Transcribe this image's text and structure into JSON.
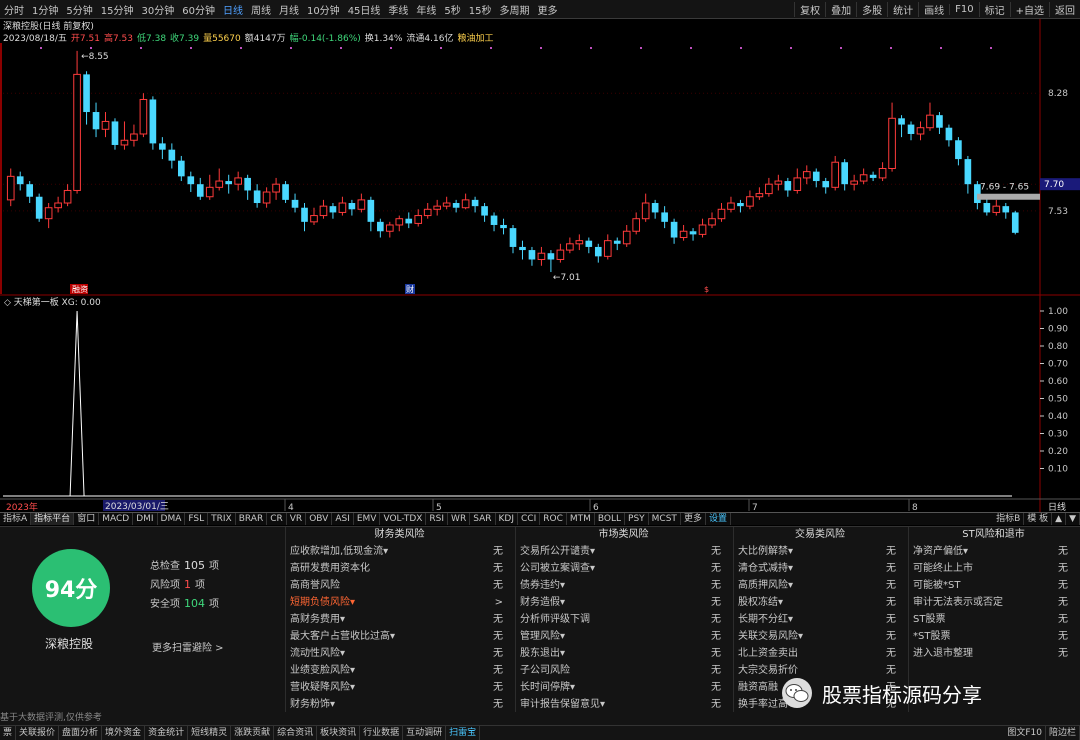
{
  "colors": {
    "up": "#ff3b3b",
    "down": "#4ad8ff",
    "bg": "#000000",
    "accent": "#4fa0ff"
  },
  "toolbar": {
    "timeframes": [
      "分时",
      "1分钟",
      "5分钟",
      "15分钟",
      "30分钟",
      "60分钟",
      "日线",
      "周线",
      "月线",
      "10分钟",
      "45日线",
      "季线",
      "年线",
      "5秒",
      "15秒",
      "多周期",
      "更多"
    ],
    "active_index": 6,
    "right_buttons": [
      "复权",
      "叠加",
      "多股",
      "统计",
      "画线",
      "F10",
      "标记",
      "+自选",
      "返回"
    ]
  },
  "stock_header": {
    "name_line": "深粮控股(日线 前复权)",
    "date": "2023/08/18/五",
    "open": "开7.51",
    "high": "高7.53",
    "low": "低7.38",
    "close": "收7.39",
    "volume": "量55670",
    "amount": "额4147万",
    "change": "幅-0.14(-1.86%)",
    "turnover": "换1.34%",
    "float": "流通4.16亿",
    "industry": "粮油加工"
  },
  "chart_data": {
    "type": "candlestick",
    "price_labels": [
      "8.28",
      "7.70",
      "7.53"
    ],
    "current_price_tag": "7.70",
    "range_label": "7.69 - 7.65",
    "high_label": "8.55",
    "low_label": "7.01",
    "event_labels": [
      "融资",
      "财",
      "$"
    ],
    "candles": [
      {
        "o": 7.6,
        "c": 7.75,
        "h": 7.8,
        "l": 7.56
      },
      {
        "o": 7.75,
        "c": 7.7,
        "h": 7.78,
        "l": 7.66
      },
      {
        "o": 7.7,
        "c": 7.62,
        "h": 7.72,
        "l": 7.58
      },
      {
        "o": 7.62,
        "c": 7.48,
        "h": 7.64,
        "l": 7.46
      },
      {
        "o": 7.48,
        "c": 7.55,
        "h": 7.58,
        "l": 7.42
      },
      {
        "o": 7.55,
        "c": 7.58,
        "h": 7.62,
        "l": 7.52
      },
      {
        "o": 7.58,
        "c": 7.66,
        "h": 7.7,
        "l": 7.56
      },
      {
        "o": 7.66,
        "c": 8.4,
        "h": 8.55,
        "l": 7.64
      },
      {
        "o": 8.4,
        "c": 8.16,
        "h": 8.42,
        "l": 8.08
      },
      {
        "o": 8.16,
        "c": 8.05,
        "h": 8.22,
        "l": 8.0
      },
      {
        "o": 8.05,
        "c": 8.1,
        "h": 8.16,
        "l": 8.0
      },
      {
        "o": 8.1,
        "c": 7.95,
        "h": 8.12,
        "l": 7.92
      },
      {
        "o": 7.95,
        "c": 7.98,
        "h": 8.1,
        "l": 7.92
      },
      {
        "o": 7.98,
        "c": 8.02,
        "h": 8.08,
        "l": 7.94
      },
      {
        "o": 8.02,
        "c": 8.24,
        "h": 8.28,
        "l": 8.0
      },
      {
        "o": 8.24,
        "c": 7.96,
        "h": 8.26,
        "l": 7.92
      },
      {
        "o": 7.96,
        "c": 7.92,
        "h": 8.0,
        "l": 7.86
      },
      {
        "o": 7.92,
        "c": 7.85,
        "h": 7.96,
        "l": 7.8
      },
      {
        "o": 7.85,
        "c": 7.75,
        "h": 7.88,
        "l": 7.72
      },
      {
        "o": 7.75,
        "c": 7.7,
        "h": 7.78,
        "l": 7.65
      },
      {
        "o": 7.7,
        "c": 7.62,
        "h": 7.74,
        "l": 7.6
      },
      {
        "o": 7.62,
        "c": 7.68,
        "h": 7.76,
        "l": 7.6
      },
      {
        "o": 7.68,
        "c": 7.72,
        "h": 7.8,
        "l": 7.66
      },
      {
        "o": 7.72,
        "c": 7.7,
        "h": 7.76,
        "l": 7.64
      },
      {
        "o": 7.7,
        "c": 7.74,
        "h": 7.78,
        "l": 7.66
      },
      {
        "o": 7.74,
        "c": 7.66,
        "h": 7.76,
        "l": 7.6
      },
      {
        "o": 7.66,
        "c": 7.58,
        "h": 7.7,
        "l": 7.55
      },
      {
        "o": 7.58,
        "c": 7.65,
        "h": 7.68,
        "l": 7.55
      },
      {
        "o": 7.65,
        "c": 7.7,
        "h": 7.74,
        "l": 7.6
      },
      {
        "o": 7.7,
        "c": 7.6,
        "h": 7.72,
        "l": 7.58
      },
      {
        "o": 7.6,
        "c": 7.55,
        "h": 7.64,
        "l": 7.52
      },
      {
        "o": 7.55,
        "c": 7.46,
        "h": 7.58,
        "l": 7.4
      },
      {
        "o": 7.46,
        "c": 7.5,
        "h": 7.55,
        "l": 7.44
      },
      {
        "o": 7.5,
        "c": 7.56,
        "h": 7.6,
        "l": 7.48
      },
      {
        "o": 7.56,
        "c": 7.52,
        "h": 7.58,
        "l": 7.48
      },
      {
        "o": 7.52,
        "c": 7.58,
        "h": 7.62,
        "l": 7.5
      },
      {
        "o": 7.58,
        "c": 7.54,
        "h": 7.6,
        "l": 7.5
      },
      {
        "o": 7.54,
        "c": 7.6,
        "h": 7.64,
        "l": 7.52
      },
      {
        "o": 7.6,
        "c": 7.46,
        "h": 7.62,
        "l": 7.4
      },
      {
        "o": 7.46,
        "c": 7.4,
        "h": 7.48,
        "l": 7.36
      },
      {
        "o": 7.4,
        "c": 7.44,
        "h": 7.46,
        "l": 7.36
      },
      {
        "o": 7.44,
        "c": 7.48,
        "h": 7.5,
        "l": 7.4
      },
      {
        "o": 7.48,
        "c": 7.45,
        "h": 7.52,
        "l": 7.42
      },
      {
        "o": 7.45,
        "c": 7.5,
        "h": 7.54,
        "l": 7.43
      },
      {
        "o": 7.5,
        "c": 7.54,
        "h": 7.58,
        "l": 7.48
      },
      {
        "o": 7.54,
        "c": 7.56,
        "h": 7.6,
        "l": 7.5
      },
      {
        "o": 7.56,
        "c": 7.58,
        "h": 7.62,
        "l": 7.54
      },
      {
        "o": 7.58,
        "c": 7.55,
        "h": 7.6,
        "l": 7.52
      },
      {
        "o": 7.55,
        "c": 7.6,
        "h": 7.64,
        "l": 7.54
      },
      {
        "o": 7.6,
        "c": 7.56,
        "h": 7.62,
        "l": 7.52
      },
      {
        "o": 7.56,
        "c": 7.5,
        "h": 7.58,
        "l": 7.46
      },
      {
        "o": 7.5,
        "c": 7.44,
        "h": 7.52,
        "l": 7.4
      },
      {
        "o": 7.44,
        "c": 7.42,
        "h": 7.48,
        "l": 7.38
      },
      {
        "o": 7.42,
        "c": 7.3,
        "h": 7.44,
        "l": 7.26
      },
      {
        "o": 7.3,
        "c": 7.28,
        "h": 7.34,
        "l": 7.22
      },
      {
        "o": 7.28,
        "c": 7.22,
        "h": 7.3,
        "l": 7.18
      },
      {
        "o": 7.22,
        "c": 7.26,
        "h": 7.3,
        "l": 7.18
      },
      {
        "o": 7.26,
        "c": 7.22,
        "h": 7.28,
        "l": 7.14
      },
      {
        "o": 7.22,
        "c": 7.28,
        "h": 7.32,
        "l": 7.2
      },
      {
        "o": 7.28,
        "c": 7.32,
        "h": 7.36,
        "l": 7.26
      },
      {
        "o": 7.32,
        "c": 7.34,
        "h": 7.38,
        "l": 7.28
      },
      {
        "o": 7.34,
        "c": 7.3,
        "h": 7.36,
        "l": 7.26
      },
      {
        "o": 7.3,
        "c": 7.24,
        "h": 7.32,
        "l": 7.2
      },
      {
        "o": 7.24,
        "c": 7.34,
        "h": 7.38,
        "l": 7.22
      },
      {
        "o": 7.34,
        "c": 7.32,
        "h": 7.36,
        "l": 7.28
      },
      {
        "o": 7.32,
        "c": 7.4,
        "h": 7.44,
        "l": 7.3
      },
      {
        "o": 7.4,
        "c": 7.48,
        "h": 7.52,
        "l": 7.38
      },
      {
        "o": 7.48,
        "c": 7.58,
        "h": 7.64,
        "l": 7.46
      },
      {
        "o": 7.58,
        "c": 7.52,
        "h": 7.6,
        "l": 7.48
      },
      {
        "o": 7.52,
        "c": 7.46,
        "h": 7.56,
        "l": 7.42
      },
      {
        "o": 7.46,
        "c": 7.36,
        "h": 7.48,
        "l": 7.32
      },
      {
        "o": 7.36,
        "c": 7.4,
        "h": 7.44,
        "l": 7.34
      },
      {
        "o": 7.4,
        "c": 7.38,
        "h": 7.42,
        "l": 7.34
      },
      {
        "o": 7.38,
        "c": 7.44,
        "h": 7.48,
        "l": 7.36
      },
      {
        "o": 7.44,
        "c": 7.48,
        "h": 7.52,
        "l": 7.42
      },
      {
        "o": 7.48,
        "c": 7.54,
        "h": 7.58,
        "l": 7.46
      },
      {
        "o": 7.54,
        "c": 7.58,
        "h": 7.62,
        "l": 7.52
      },
      {
        "o": 7.58,
        "c": 7.56,
        "h": 7.6,
        "l": 7.52
      },
      {
        "o": 7.56,
        "c": 7.62,
        "h": 7.66,
        "l": 7.54
      },
      {
        "o": 7.62,
        "c": 7.64,
        "h": 7.68,
        "l": 7.6
      },
      {
        "o": 7.64,
        "c": 7.7,
        "h": 7.74,
        "l": 7.62
      },
      {
        "o": 7.7,
        "c": 7.72,
        "h": 7.76,
        "l": 7.66
      },
      {
        "o": 7.72,
        "c": 7.66,
        "h": 7.74,
        "l": 7.62
      },
      {
        "o": 7.66,
        "c": 7.74,
        "h": 7.8,
        "l": 7.64
      },
      {
        "o": 7.74,
        "c": 7.78,
        "h": 7.82,
        "l": 7.7
      },
      {
        "o": 7.78,
        "c": 7.72,
        "h": 7.8,
        "l": 7.68
      },
      {
        "o": 7.72,
        "c": 7.68,
        "h": 7.74,
        "l": 7.64
      },
      {
        "o": 7.68,
        "c": 7.84,
        "h": 7.88,
        "l": 7.66
      },
      {
        "o": 7.84,
        "c": 7.7,
        "h": 7.86,
        "l": 7.66
      },
      {
        "o": 7.7,
        "c": 7.72,
        "h": 7.76,
        "l": 7.66
      },
      {
        "o": 7.72,
        "c": 7.76,
        "h": 7.8,
        "l": 7.7
      },
      {
        "o": 7.76,
        "c": 7.74,
        "h": 7.78,
        "l": 7.72
      },
      {
        "o": 7.74,
        "c": 7.8,
        "h": 7.84,
        "l": 7.72
      },
      {
        "o": 7.8,
        "c": 8.12,
        "h": 8.22,
        "l": 7.78
      },
      {
        "o": 8.12,
        "c": 8.08,
        "h": 8.14,
        "l": 8.0
      },
      {
        "o": 8.08,
        "c": 8.02,
        "h": 8.1,
        "l": 7.98
      },
      {
        "o": 8.02,
        "c": 8.06,
        "h": 8.1,
        "l": 7.98
      },
      {
        "o": 8.06,
        "c": 8.14,
        "h": 8.22,
        "l": 8.04
      },
      {
        "o": 8.14,
        "c": 8.06,
        "h": 8.16,
        "l": 8.02
      },
      {
        "o": 8.06,
        "c": 7.98,
        "h": 8.08,
        "l": 7.94
      },
      {
        "o": 7.98,
        "c": 7.86,
        "h": 8.0,
        "l": 7.82
      },
      {
        "o": 7.86,
        "c": 7.7,
        "h": 7.88,
        "l": 7.64
      },
      {
        "o": 7.7,
        "c": 7.58,
        "h": 7.72,
        "l": 7.54
      },
      {
        "o": 7.58,
        "c": 7.52,
        "h": 7.62,
        "l": 7.5
      },
      {
        "o": 7.52,
        "c": 7.56,
        "h": 7.6,
        "l": 7.5
      },
      {
        "o": 7.56,
        "c": 7.52,
        "h": 7.58,
        "l": 7.48
      },
      {
        "o": 7.52,
        "c": 7.39,
        "h": 7.53,
        "l": 7.38
      }
    ],
    "ylim": [
      7.0,
      8.6
    ]
  },
  "indicator": {
    "title": "天梯第一板 XG: 0.00",
    "ticks": [
      "1.00",
      "0.90",
      "0.80",
      "0.70",
      "0.60",
      "0.50",
      "0.40",
      "0.30",
      "0.20",
      "0.10"
    ],
    "signals": [
      0,
      0,
      0,
      0,
      0,
      0,
      0,
      1
    ]
  },
  "timeline": {
    "start": "2023年",
    "cursor_date": "2023/03/01/三",
    "months": [
      "4",
      "5",
      "6",
      "7",
      "8"
    ],
    "right_label": "日线"
  },
  "indicator_tabs": [
    "指标A",
    "指标平台",
    "窗口",
    "MACD",
    "DMI",
    "DMA",
    "FSL",
    "TRIX",
    "BRAR",
    "CR",
    "VR",
    "OBV",
    "ASI",
    "EMV",
    "VOL-TDX",
    "RSI",
    "WR",
    "SAR",
    "KDJ",
    "CCI",
    "ROC",
    "MTM",
    "BOLL",
    "PSY",
    "MCST",
    "更多",
    "设置"
  ],
  "indicator_tabs_right": [
    "指标B",
    "模 板",
    "▲",
    "▼"
  ],
  "risk_panel": {
    "score": "94分",
    "stock_name": "深粮控股",
    "total_label": "总检查",
    "total_value": "105",
    "total_unit": "项",
    "risk_label": "风险项",
    "risk_value": "1",
    "risk_unit": "项",
    "safe_label": "安全项",
    "safe_value": "104",
    "safe_unit": "项",
    "more_scan": "更多扫雷避险 >",
    "disclaimer": "基于大数据评测,仅供参考",
    "columns": [
      {
        "title": "财务类风险",
        "items": [
          {
            "label": "应收款增加,低现金流▾",
            "status": "无"
          },
          {
            "label": "高研发费用资本化",
            "status": "无"
          },
          {
            "label": "高商誉风险",
            "status": "无"
          },
          {
            "label": "短期负债风险▾",
            "status": ">",
            "warn": true
          },
          {
            "label": "高财务费用▾",
            "status": "无"
          },
          {
            "label": "最大客户占营收比过高▾",
            "status": "无"
          },
          {
            "label": "流动性风险▾",
            "status": "无"
          },
          {
            "label": "业绩变脸风险▾",
            "status": "无"
          },
          {
            "label": "营收疑降风险▾",
            "status": "无"
          },
          {
            "label": "财务粉饰▾",
            "status": "无"
          }
        ]
      },
      {
        "title": "市场类风险",
        "items": [
          {
            "label": "交易所公开谴责▾",
            "status": "无"
          },
          {
            "label": "公司被立案调查▾",
            "status": "无"
          },
          {
            "label": "债券违约▾",
            "status": "无"
          },
          {
            "label": "财务造假▾",
            "status": "无"
          },
          {
            "label": "分析师评级下调",
            "status": "无"
          },
          {
            "label": "管理风险▾",
            "status": "无"
          },
          {
            "label": "股东退出▾",
            "status": "无"
          },
          {
            "label": "子公司风险",
            "status": "无"
          },
          {
            "label": "长时间停牌▾",
            "status": "无"
          },
          {
            "label": "审计报告保留意见▾",
            "status": "无"
          }
        ]
      },
      {
        "title": "交易类风险",
        "items": [
          {
            "label": "大比例解禁▾",
            "status": "无"
          },
          {
            "label": "清仓式减持▾",
            "status": "无"
          },
          {
            "label": "高质押风险▾",
            "status": "无"
          },
          {
            "label": "股权冻结▾",
            "status": "无"
          },
          {
            "label": "长期不分红▾",
            "status": "无"
          },
          {
            "label": "关联交易风险▾",
            "status": "无"
          },
          {
            "label": "北上资金卖出",
            "status": "无"
          },
          {
            "label": "大宗交易折价",
            "status": "无"
          },
          {
            "label": "融资高融",
            "status": "无"
          },
          {
            "label": "换手率过高▾",
            "status": "无"
          }
        ]
      },
      {
        "title": "ST风险和退市",
        "items": [
          {
            "label": "净资产偏低▾",
            "status": "无"
          },
          {
            "label": "可能终止上市",
            "status": "无"
          },
          {
            "label": "可能被*ST",
            "status": "无"
          },
          {
            "label": "审计无法表示或否定",
            "status": "无"
          },
          {
            "label": "ST股票",
            "status": "无"
          },
          {
            "label": "*ST股票",
            "status": "无"
          },
          {
            "label": "进入退市整理",
            "status": "无"
          }
        ]
      }
    ]
  },
  "watermark": {
    "text": "股票指标源码分享",
    "icon": "wechat-icon"
  },
  "bottom_tabs": [
    "票",
    "关联报价",
    "盘面分析",
    "境外资金",
    "资金统计",
    "短线精灵",
    "涨跌贡献",
    "综合资讯",
    "板块资讯",
    "行业数据",
    "互动调研",
    "扫雷宝"
  ],
  "bottom_active_index": 11,
  "bottom_right": [
    "图文F10",
    "陪边栏"
  ]
}
